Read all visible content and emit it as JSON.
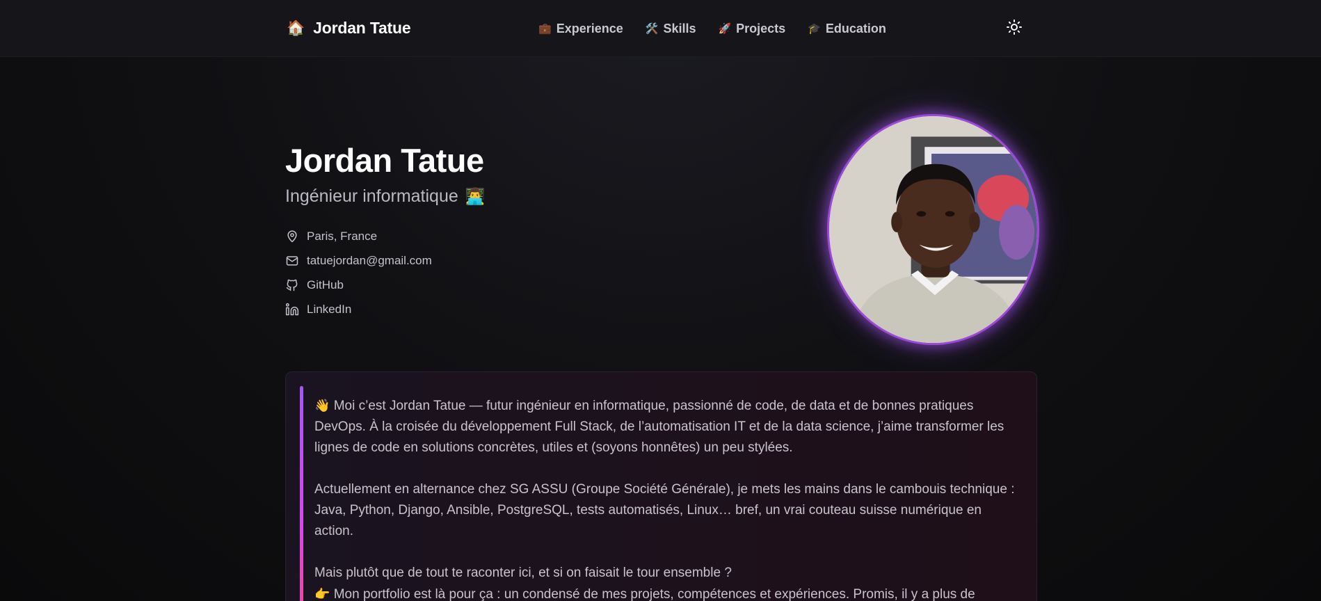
{
  "header": {
    "brand_icon": "🏠",
    "brand_name": "Jordan Tatue",
    "nav": [
      {
        "icon": "💼",
        "label": "Experience"
      },
      {
        "icon": "🛠️",
        "label": "Skills"
      },
      {
        "icon": "🚀",
        "label": "Projects"
      },
      {
        "icon": "🎓",
        "label": "Education"
      }
    ],
    "theme_toggle_icon": "sun-icon"
  },
  "hero": {
    "name": "Jordan Tatue",
    "role": "Ingénieur informatique",
    "role_emoji": "👨‍💻",
    "contacts": [
      {
        "icon": "map-pin-icon",
        "text": "Paris, France"
      },
      {
        "icon": "mail-icon",
        "text": "tatuejordan@gmail.com"
      },
      {
        "icon": "github-icon",
        "text": "GitHub"
      },
      {
        "icon": "linkedin-icon",
        "text": "LinkedIn"
      }
    ]
  },
  "about": {
    "p1_emoji": "👋",
    "p1": "Moi c’est Jordan Tatue — futur ingénieur en informatique, passionné de code, de data et de bonnes pratiques DevOps. À la croisée du développement Full Stack, de l’automatisation IT et de la data science, j’aime transformer les lignes de code en solutions concrètes, utiles et (soyons honnêtes) un peu stylées.",
    "p2": "Actuellement en alternance chez SG ASSU (Groupe Société Générale), je mets les mains dans le cambouis technique : Java, Python, Django, Ansible, PostgreSQL, tests automatisés, Linux… bref, un vrai couteau suisse numérique en action.",
    "p3": "Mais plutôt que de tout te raconter ici, et si on faisait le tour ensemble ?",
    "p4_emoji": "👉",
    "p4": "Mon portfolio est là pour ça : un condensé de mes projets, compétences et expériences. Promis, il y a plus de"
  },
  "colors": {
    "accent_purple": "#a855f7",
    "accent_pink": "#ec4899",
    "header_bg": "#15151a",
    "page_bg": "#0b0b0d"
  }
}
